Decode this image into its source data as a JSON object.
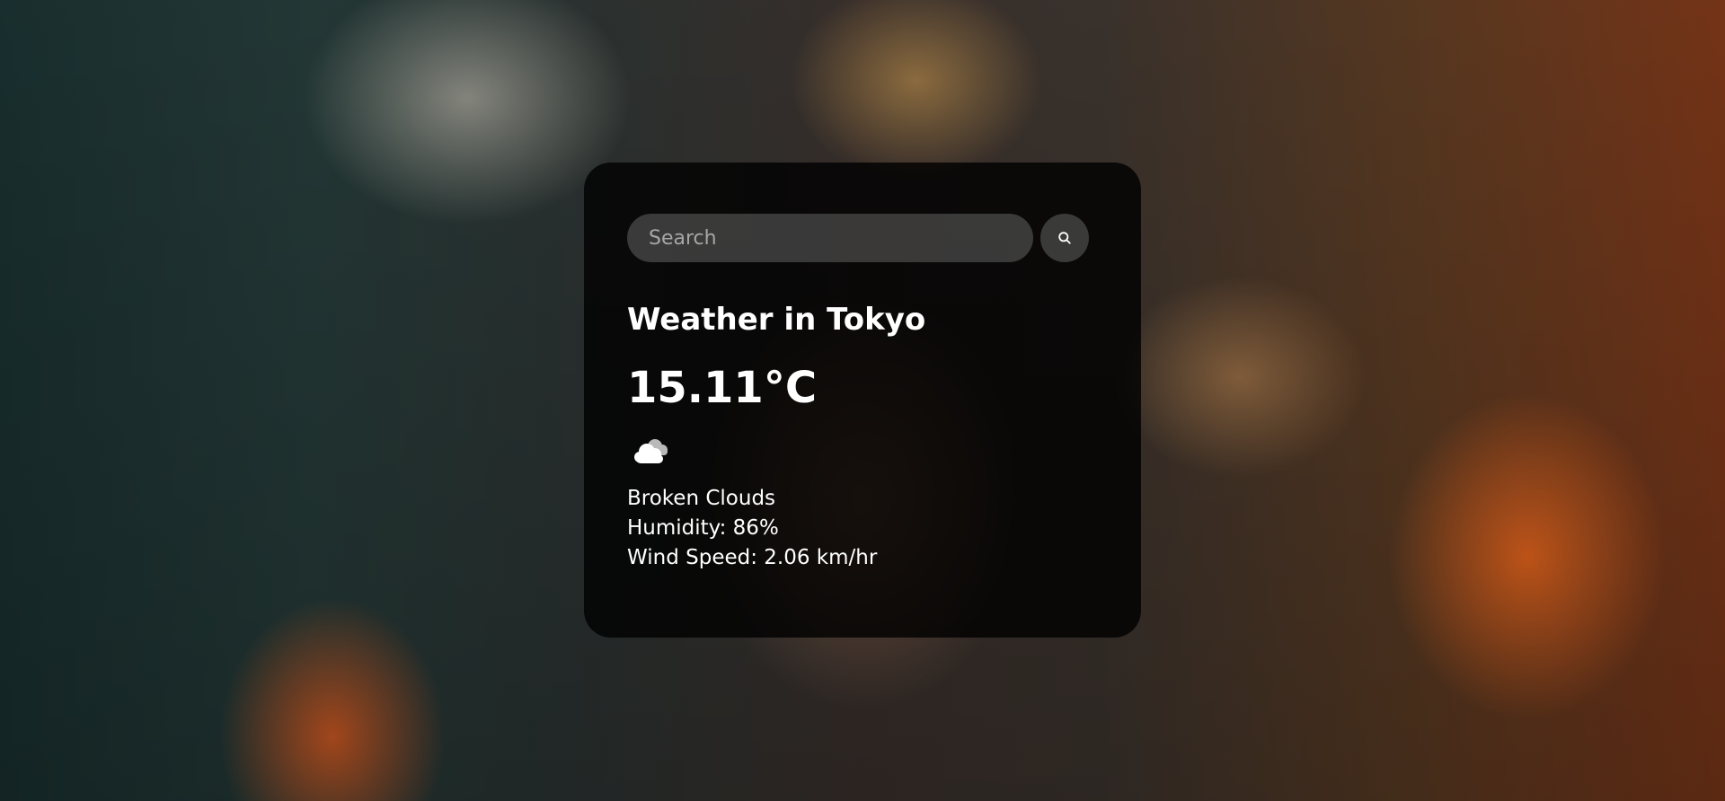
{
  "search": {
    "placeholder": "Search",
    "icon": "search-icon"
  },
  "weather": {
    "title": "Weather in Tokyo",
    "temperature": "15.11°C",
    "icon": "cloud-icon",
    "description": "Broken Clouds",
    "humidity": "Humidity: 86%",
    "wind": "Wind Speed: 2.06 km/hr"
  },
  "colors": {
    "card_background": "#000000cc",
    "text": "#ffffff",
    "input_background": "#7c7c7c6e"
  }
}
